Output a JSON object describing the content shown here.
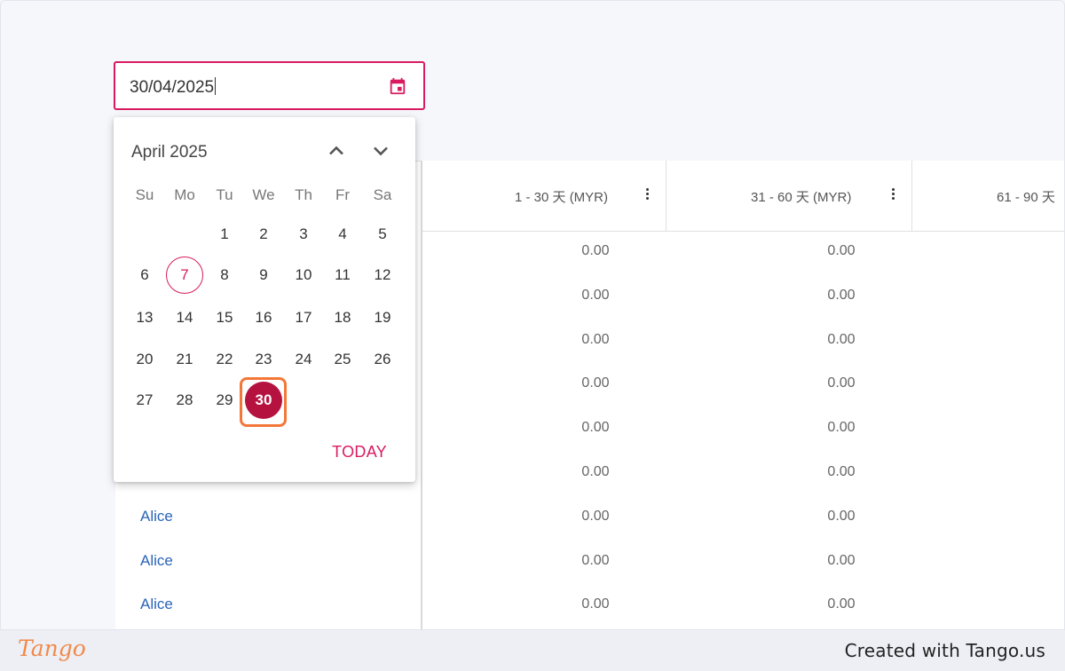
{
  "date_input": {
    "value": "30/04/2025",
    "icon": "calendar-icon"
  },
  "calendar": {
    "month_label": "April 2025",
    "weekdays": [
      "Su",
      "Mo",
      "Tu",
      "We",
      "Th",
      "Fr",
      "Sa"
    ],
    "weeks": [
      [
        "",
        "",
        "1",
        "2",
        "3",
        "4",
        "5"
      ],
      [
        "6",
        "7",
        "8",
        "9",
        "10",
        "11",
        "12"
      ],
      [
        "13",
        "14",
        "15",
        "16",
        "17",
        "18",
        "19"
      ],
      [
        "20",
        "21",
        "22",
        "23",
        "24",
        "25",
        "26"
      ],
      [
        "27",
        "28",
        "29",
        "30",
        "",
        "",
        ""
      ]
    ],
    "today_day": "7",
    "selected_day": "30",
    "today_button": "TODAY",
    "accent_color": "#d81b60",
    "selected_color": "#b5123f",
    "highlight_color": "#f4773a"
  },
  "table": {
    "columns": [
      {
        "label": "1 - 30 天 (MYR)"
      },
      {
        "label": "31 - 60 天 (MYR)"
      },
      {
        "label": "61 - 90 天"
      }
    ],
    "rows": [
      {
        "name": "",
        "c1": "0.00",
        "c2": "0.00"
      },
      {
        "name": "",
        "c1": "0.00",
        "c2": "0.00"
      },
      {
        "name": "",
        "c1": "0.00",
        "c2": "0.00"
      },
      {
        "name": "",
        "c1": "0.00",
        "c2": "0.00"
      },
      {
        "name": "",
        "c1": "0.00",
        "c2": "0.00"
      },
      {
        "name": "",
        "c1": "0.00",
        "c2": "0.00"
      },
      {
        "name": "Alice",
        "c1": "0.00",
        "c2": "0.00"
      },
      {
        "name": "Alice",
        "c1": "0.00",
        "c2": "0.00"
      },
      {
        "name": "Alice",
        "c1": "0.00",
        "c2": "0.00"
      }
    ]
  },
  "footer": {
    "logo": "Tango",
    "credit": "Created with Tango.us"
  }
}
